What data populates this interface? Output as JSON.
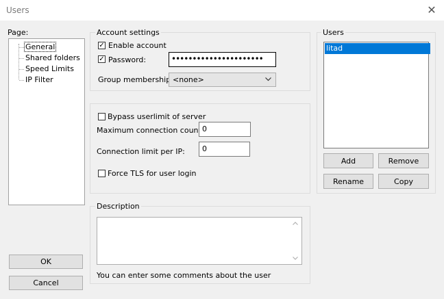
{
  "window": {
    "title": "Users",
    "close_glyph": "✕"
  },
  "page_panel": {
    "label": "Page:",
    "items": [
      "General",
      "Shared folders",
      "Speed Limits",
      "IP Filter"
    ]
  },
  "account_settings": {
    "title": "Account settings",
    "enable_account": {
      "label": "Enable account",
      "checked": true
    },
    "password": {
      "label": "Password:",
      "checked": true,
      "value": "••••••••••••••••••••••"
    },
    "group_membership": {
      "label": "Group membership:",
      "selected": "<none>"
    }
  },
  "limits": {
    "bypass": {
      "label": "Bypass userlimit of server",
      "checked": false
    },
    "max_connections": {
      "label": "Maximum connection count:",
      "value": "0"
    },
    "limit_per_ip": {
      "label": "Connection limit per IP:",
      "value": "0"
    },
    "force_tls": {
      "label": "Force TLS for user login",
      "checked": false
    }
  },
  "description": {
    "title": "Description",
    "value": "",
    "hint": "You can enter some comments about the user"
  },
  "users_panel": {
    "title": "Users",
    "items": [
      "litad"
    ],
    "buttons": {
      "add": "Add",
      "remove": "Remove",
      "rename": "Rename",
      "copy": "Copy"
    }
  },
  "footer": {
    "ok": "OK",
    "cancel": "Cancel"
  },
  "colors": {
    "selection": "#0078d7",
    "background": "#f0f0f0"
  },
  "icons": {
    "close": "close-icon",
    "dropdown": "chevron-down-icon",
    "checkmark": "check-icon"
  }
}
